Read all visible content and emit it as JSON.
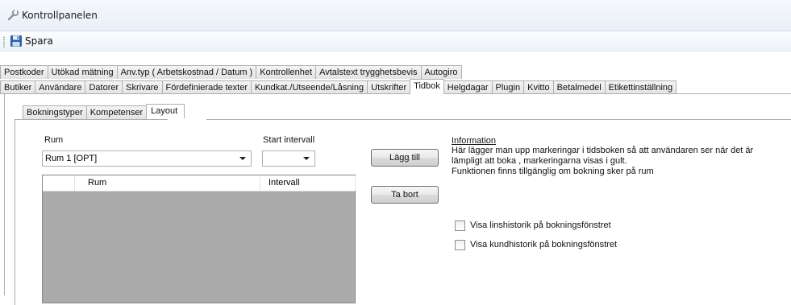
{
  "window": {
    "title": "Kontrollpanelen",
    "icon": "wrench-icon"
  },
  "toolbar": {
    "save_label": "Spara",
    "save_icon": "floppy-disk-icon"
  },
  "tabs_row1": [
    "Postkoder",
    "Utökad mätning",
    "Anv.typ ( Arbetskostnad / Datum )",
    "Kontrollenhet",
    "Avtalstext trygghetsbevis",
    "Autogiro"
  ],
  "tabs_row2": [
    "Butiker",
    "Användare",
    "Datorer",
    "Skrivare",
    "Fördefinierade texter",
    "Kundkat./Utseende/Låsning",
    "Utskrifter",
    "Tidbok",
    "Helgdagar",
    "Plugin",
    "Kvitto",
    "Betalmedel",
    "Etikettinställning"
  ],
  "tabs_row2_selected": "Tidbok",
  "subtabs": [
    "Bokningstyper",
    "Kompetenser",
    "Layout"
  ],
  "subtabs_selected": "Layout",
  "form": {
    "room_label": "Rum",
    "room_value": "Rum 1 [OPT]",
    "interval_label": "Start intervall",
    "interval_value": "",
    "add_button": "Lägg till",
    "remove_button": "Ta bort"
  },
  "grid": {
    "columns": [
      "Rum",
      "Intervall"
    ],
    "rows": []
  },
  "info": {
    "heading": "Information",
    "lines": [
      "Här lägger man upp markeringar i tidsboken så att användaren ser när det är",
      "lämpligt att boka , markeringarna visas i gult.",
      "Funktionen finns tillgänglig om bokning sker på rum"
    ]
  },
  "checkboxes": [
    {
      "label": "Visa linshistorik på bokningsfönstret",
      "checked": false
    },
    {
      "label": "Visa kundhistorik på bokningsfönstret",
      "checked": false
    }
  ]
}
